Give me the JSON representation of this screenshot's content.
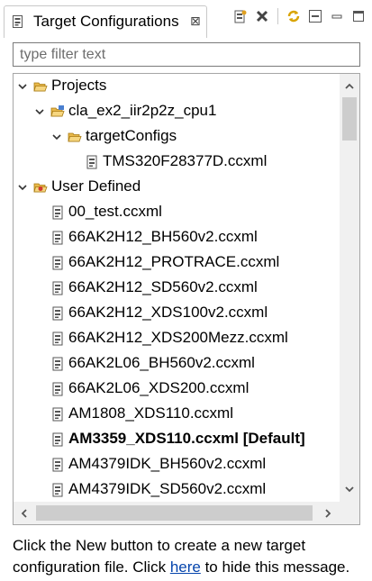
{
  "tab": {
    "title": "Target Configurations",
    "icon": "ccxml-file-icon",
    "close_symbol": "⊠"
  },
  "toolbar": {
    "items": [
      {
        "name": "new-configuration-button",
        "icon": "new-config-icon"
      },
      {
        "name": "delete-button",
        "icon": "delete-x-icon"
      },
      {
        "name": "refresh-button",
        "icon": "refresh-icon"
      },
      {
        "name": "collapse-all-button",
        "icon": "collapse-all-icon"
      },
      {
        "name": "minimize-button",
        "icon": "minimize-icon"
      },
      {
        "name": "maximize-button",
        "icon": "maximize-icon"
      }
    ]
  },
  "filter": {
    "placeholder": "type filter text",
    "value": ""
  },
  "tree": {
    "nodes": [
      {
        "label": "Projects",
        "level": 0,
        "expandable": true,
        "expanded": true,
        "icon": "open-folder-icon"
      },
      {
        "label": "cla_ex2_iir2p2z_cpu1",
        "level": 1,
        "expandable": true,
        "expanded": true,
        "icon": "project-folder-icon"
      },
      {
        "label": "targetConfigs",
        "level": 2,
        "expandable": true,
        "expanded": true,
        "icon": "open-folder-icon"
      },
      {
        "label": "TMS320F28377D.ccxml",
        "level": 3,
        "expandable": false,
        "icon": "ccxml-file-icon"
      },
      {
        "label": "User Defined",
        "level": 0,
        "expandable": true,
        "expanded": true,
        "icon": "user-folder-icon"
      },
      {
        "label": "00_test.ccxml",
        "level": 1,
        "expandable": false,
        "icon": "ccxml-file-icon"
      },
      {
        "label": "66AK2H12_BH560v2.ccxml",
        "level": 1,
        "expandable": false,
        "icon": "ccxml-file-icon"
      },
      {
        "label": "66AK2H12_PROTRACE.ccxml",
        "level": 1,
        "expandable": false,
        "icon": "ccxml-file-icon"
      },
      {
        "label": "66AK2H12_SD560v2.ccxml",
        "level": 1,
        "expandable": false,
        "icon": "ccxml-file-icon"
      },
      {
        "label": "66AK2H12_XDS100v2.ccxml",
        "level": 1,
        "expandable": false,
        "icon": "ccxml-file-icon"
      },
      {
        "label": "66AK2H12_XDS200Mezz.ccxml",
        "level": 1,
        "expandable": false,
        "icon": "ccxml-file-icon"
      },
      {
        "label": "66AK2L06_BH560v2.ccxml",
        "level": 1,
        "expandable": false,
        "icon": "ccxml-file-icon"
      },
      {
        "label": "66AK2L06_XDS200.ccxml",
        "level": 1,
        "expandable": false,
        "icon": "ccxml-file-icon"
      },
      {
        "label": "AM1808_XDS110.ccxml",
        "level": 1,
        "expandable": false,
        "icon": "ccxml-file-icon"
      },
      {
        "label": "AM3359_XDS110.ccxml [Default]",
        "level": 1,
        "expandable": false,
        "icon": "ccxml-file-icon",
        "bold": true
      },
      {
        "label": "AM4379IDK_BH560v2.ccxml",
        "level": 1,
        "expandable": false,
        "icon": "ccxml-file-icon"
      },
      {
        "label": "AM4379IDK_SD560v2.ccxml",
        "level": 1,
        "expandable": false,
        "icon": "ccxml-file-icon"
      }
    ]
  },
  "message": {
    "before_link": "Click the New button to create a new target configuration file. Click ",
    "link": "here",
    "after_link": " to hide this message."
  },
  "colors": {
    "folder": "#e8b84a",
    "link": "#0645ad",
    "scroll_track": "#f0f0f0",
    "scroll_thumb": "#cdcdcd"
  }
}
